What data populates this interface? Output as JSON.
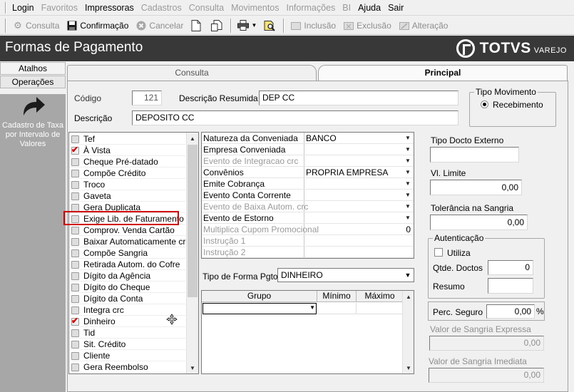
{
  "menu": {
    "items": [
      {
        "label": "Login",
        "enabled": true
      },
      {
        "label": "Favoritos",
        "enabled": false
      },
      {
        "label": "Impressoras",
        "enabled": true
      },
      {
        "label": "Cadastros",
        "enabled": false
      },
      {
        "label": "Consulta",
        "enabled": false
      },
      {
        "label": "Movimentos",
        "enabled": false
      },
      {
        "label": "Informações",
        "enabled": false
      },
      {
        "label": "BI",
        "enabled": false
      },
      {
        "label": "Ajuda",
        "enabled": true
      },
      {
        "label": "Sair",
        "enabled": true
      }
    ]
  },
  "toolbar": {
    "consulta": "Consulta",
    "confirmacao": "Confirmação",
    "cancelar": "Cancelar",
    "inclusao": "Inclusão",
    "exclusao": "Exclusão",
    "alteracao": "Alteração"
  },
  "header": {
    "title": "Formas de Pagamento",
    "logo_text": "TOTVS",
    "logo_sub": "VAREJO"
  },
  "sidebar": {
    "tab_atalhos": "Atalhos",
    "tab_operacoes": "Operações",
    "shortcut_label": "Cadastro de Taxa por Intervalo de Valores"
  },
  "tabs": {
    "consulta": "Consulta",
    "principal": "Principal"
  },
  "form": {
    "codigo_label": "Código",
    "codigo_value": "121",
    "desc_resumida_label": "Descrição Resumida",
    "desc_resumida_value": "DEP CC",
    "descricao_label": "Descrição",
    "descricao_value": "DEPOSITO CC",
    "tipo_movimento_label": "Tipo Movimento",
    "tipo_movimento_value": "Recebimento"
  },
  "checklist": [
    {
      "label": "Tef",
      "checked": false
    },
    {
      "label": "À Vista",
      "checked": true
    },
    {
      "label": "Cheque Pré-datado",
      "checked": false
    },
    {
      "label": "Compõe Crédito",
      "checked": false
    },
    {
      "label": "Troco",
      "checked": false
    },
    {
      "label": "Gaveta",
      "checked": false
    },
    {
      "label": "Gera Duplicata",
      "checked": false
    },
    {
      "label": "Exige Lib. de Faturamento",
      "checked": false
    },
    {
      "label": "Comprov. Venda Cartão",
      "checked": false
    },
    {
      "label": "Baixar Automaticamente crc",
      "checked": false
    },
    {
      "label": "Compõe Sangria",
      "checked": false
    },
    {
      "label": "Retirada Autom. do Cofre",
      "checked": false
    },
    {
      "label": "Dígito da Agência",
      "checked": false
    },
    {
      "label": "Dígito do Cheque",
      "checked": false
    },
    {
      "label": "Dígito da Conta",
      "checked": false
    },
    {
      "label": "Integra crc",
      "checked": false
    },
    {
      "label": "Dinheiro",
      "checked": true
    },
    {
      "label": "Tid",
      "checked": false
    },
    {
      "label": "Sit. Crédito",
      "checked": false
    },
    {
      "label": "Cliente",
      "checked": false
    },
    {
      "label": "Gera Reembolso",
      "checked": false
    }
  ],
  "properties": [
    {
      "name": "Natureza da Conveniada",
      "value": "BANCO",
      "enabled": true,
      "dropdown": true
    },
    {
      "name": "Empresa Conveniada",
      "value": "",
      "enabled": true,
      "dropdown": true
    },
    {
      "name": "Evento de Integracao crc",
      "value": "",
      "enabled": false,
      "dropdown": true
    },
    {
      "name": "Convênios",
      "value": "PROPRIA EMPRESA",
      "enabled": true,
      "dropdown": true
    },
    {
      "name": "Emite Cobrança",
      "value": "",
      "enabled": true,
      "dropdown": true
    },
    {
      "name": "Evento Conta Corrente",
      "value": "",
      "enabled": true,
      "dropdown": true
    },
    {
      "name": "Evento de Baixa Autom. crc",
      "value": "",
      "enabled": false,
      "dropdown": true
    },
    {
      "name": "Evento de Estorno",
      "value": "",
      "enabled": true,
      "dropdown": true
    },
    {
      "name": "Multiplica Cupom Promocional",
      "value": "0",
      "enabled": false,
      "dropdown": false
    },
    {
      "name": "Instrução 1",
      "value": "",
      "enabled": false,
      "dropdown": false
    },
    {
      "name": "Instrução 2",
      "value": "",
      "enabled": false,
      "dropdown": false
    }
  ],
  "tipo_forma": {
    "label": "Tipo de Forma Pgto",
    "value": "DINHEIRO"
  },
  "grupo_grid": {
    "columns": [
      "Grupo",
      "Mínimo",
      "Máximo"
    ]
  },
  "right": {
    "tipo_docto_label": "Tipo Docto Externo",
    "tipo_docto_value": "",
    "vl_limite_label": "Vl. Limite",
    "vl_limite_value": "0,00",
    "tolerancia_label": "Tolerância na Sangria",
    "tolerancia_value": "0,00",
    "autenticacao_label": "Autenticação",
    "utiliza_label": "Utiliza",
    "qtde_doctos_label": "Qtde. Doctos",
    "qtde_doctos_value": "0",
    "resumo_label": "Resumo",
    "resumo_value": "",
    "perc_seguro_label": "Perc. Seguro",
    "perc_seguro_value": "0,00",
    "perc_symbol": "%",
    "sangria_expressa_label": "Valor de Sangria Expressa",
    "sangria_expressa_value": "0,00",
    "sangria_imediata_label": "Valor de Sangria Imediata",
    "sangria_imediata_value": "0,00"
  },
  "colors": {
    "header_bg": "#383838",
    "check_red": "#d10000",
    "highlight_red": "#d00000",
    "sidebar_bg": "#a7a7a7"
  }
}
